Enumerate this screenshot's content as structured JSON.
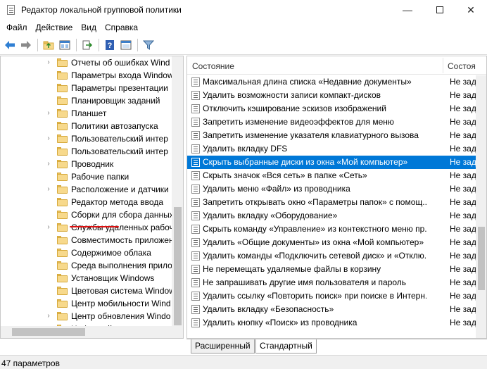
{
  "window": {
    "title": "Редактор локальной групповой политики"
  },
  "menu": [
    "Файл",
    "Действие",
    "Вид",
    "Справка"
  ],
  "tree": {
    "items": [
      {
        "label": "Отчеты об ошибках Wind",
        "expandable": true
      },
      {
        "label": "Параметры входа Window",
        "expandable": false
      },
      {
        "label": "Параметры презентации",
        "expandable": false
      },
      {
        "label": "Планировщик заданий",
        "expandable": false
      },
      {
        "label": "Планшет",
        "expandable": true
      },
      {
        "label": "Политики автозапуска",
        "expandable": false
      },
      {
        "label": "Пользовательский интер",
        "expandable": true
      },
      {
        "label": "Пользовательский интер",
        "expandable": false
      },
      {
        "label": "Проводник",
        "expandable": true,
        "selected": true
      },
      {
        "label": "Рабочие папки",
        "expandable": false
      },
      {
        "label": "Расположение и датчики",
        "expandable": true
      },
      {
        "label": "Редактор метода ввода",
        "expandable": false
      },
      {
        "label": "Сборки для сбора данных",
        "expandable": false
      },
      {
        "label": "Службы удаленных рабоч",
        "expandable": true
      },
      {
        "label": "Совместимость приложен",
        "expandable": false
      },
      {
        "label": "Содержимое облака",
        "expandable": false
      },
      {
        "label": "Среда выполнения прило",
        "expandable": false
      },
      {
        "label": "Установщик Windows",
        "expandable": false
      },
      {
        "label": "Цветовая система Window",
        "expandable": false
      },
      {
        "label": "Центр мобильности Wind",
        "expandable": false
      },
      {
        "label": "Центр обновления Windo",
        "expandable": true
      },
      {
        "label": "Цифровой ящик",
        "expandable": false
      }
    ]
  },
  "list": {
    "columns": {
      "state": "Состояние",
      "status": "Состоя"
    },
    "rows": [
      {
        "name": "Максимальная длина списка «Недавние документы»",
        "state": "Не зад"
      },
      {
        "name": "Удалить возможности записи компакт-дисков",
        "state": "Не зад"
      },
      {
        "name": "Отключить кэширование эскизов изображений",
        "state": "Не зад"
      },
      {
        "name": "Запретить изменение видеоэффектов для меню",
        "state": "Не зад"
      },
      {
        "name": "Запретить изменение указателя клавиатурного вызова",
        "state": "Не зад"
      },
      {
        "name": "Удалить вкладку DFS",
        "state": "Не зад"
      },
      {
        "name": "Скрыть выбранные диски из окна «Мой компьютер»",
        "state": "Не зад",
        "selected": true
      },
      {
        "name": "Скрыть значок «Вся сеть» в папке «Сеть»",
        "state": "Не зад"
      },
      {
        "name": "Удалить меню «Файл» из проводника",
        "state": "Не зад"
      },
      {
        "name": "Запретить открывать окно «Параметры папок» с помощ...",
        "state": "Не зад"
      },
      {
        "name": "Удалить вкладку «Оборудование»",
        "state": "Не зад"
      },
      {
        "name": "Скрыть команду «Управление» из контекстного меню пр...",
        "state": "Не зад"
      },
      {
        "name": "Удалить «Общие документы» из окна «Мой компьютер»",
        "state": "Не зад"
      },
      {
        "name": "Удалить команды «Подключить сетевой диск» и «Отклю...",
        "state": "Не зад"
      },
      {
        "name": "Не перемещать удаляемые файлы в корзину",
        "state": "Не зад"
      },
      {
        "name": "Не запрашивать другие имя пользователя и пароль",
        "state": "Не зад"
      },
      {
        "name": "Удалить ссылку «Повторить поиск» при поиске в Интерн...",
        "state": "Не зад"
      },
      {
        "name": "Удалить вкладку «Безопасность»",
        "state": "Не зад"
      },
      {
        "name": "Удалить кнопку «Поиск» из проводника",
        "state": "Не зад"
      }
    ]
  },
  "tabs": {
    "extended": "Расширенный",
    "standard": "Стандартный"
  },
  "status": {
    "text": "47 параметров"
  },
  "colors": {
    "selection": "#0078d7",
    "annotation_underline": "#d11111",
    "folder": "#f7d98c"
  }
}
